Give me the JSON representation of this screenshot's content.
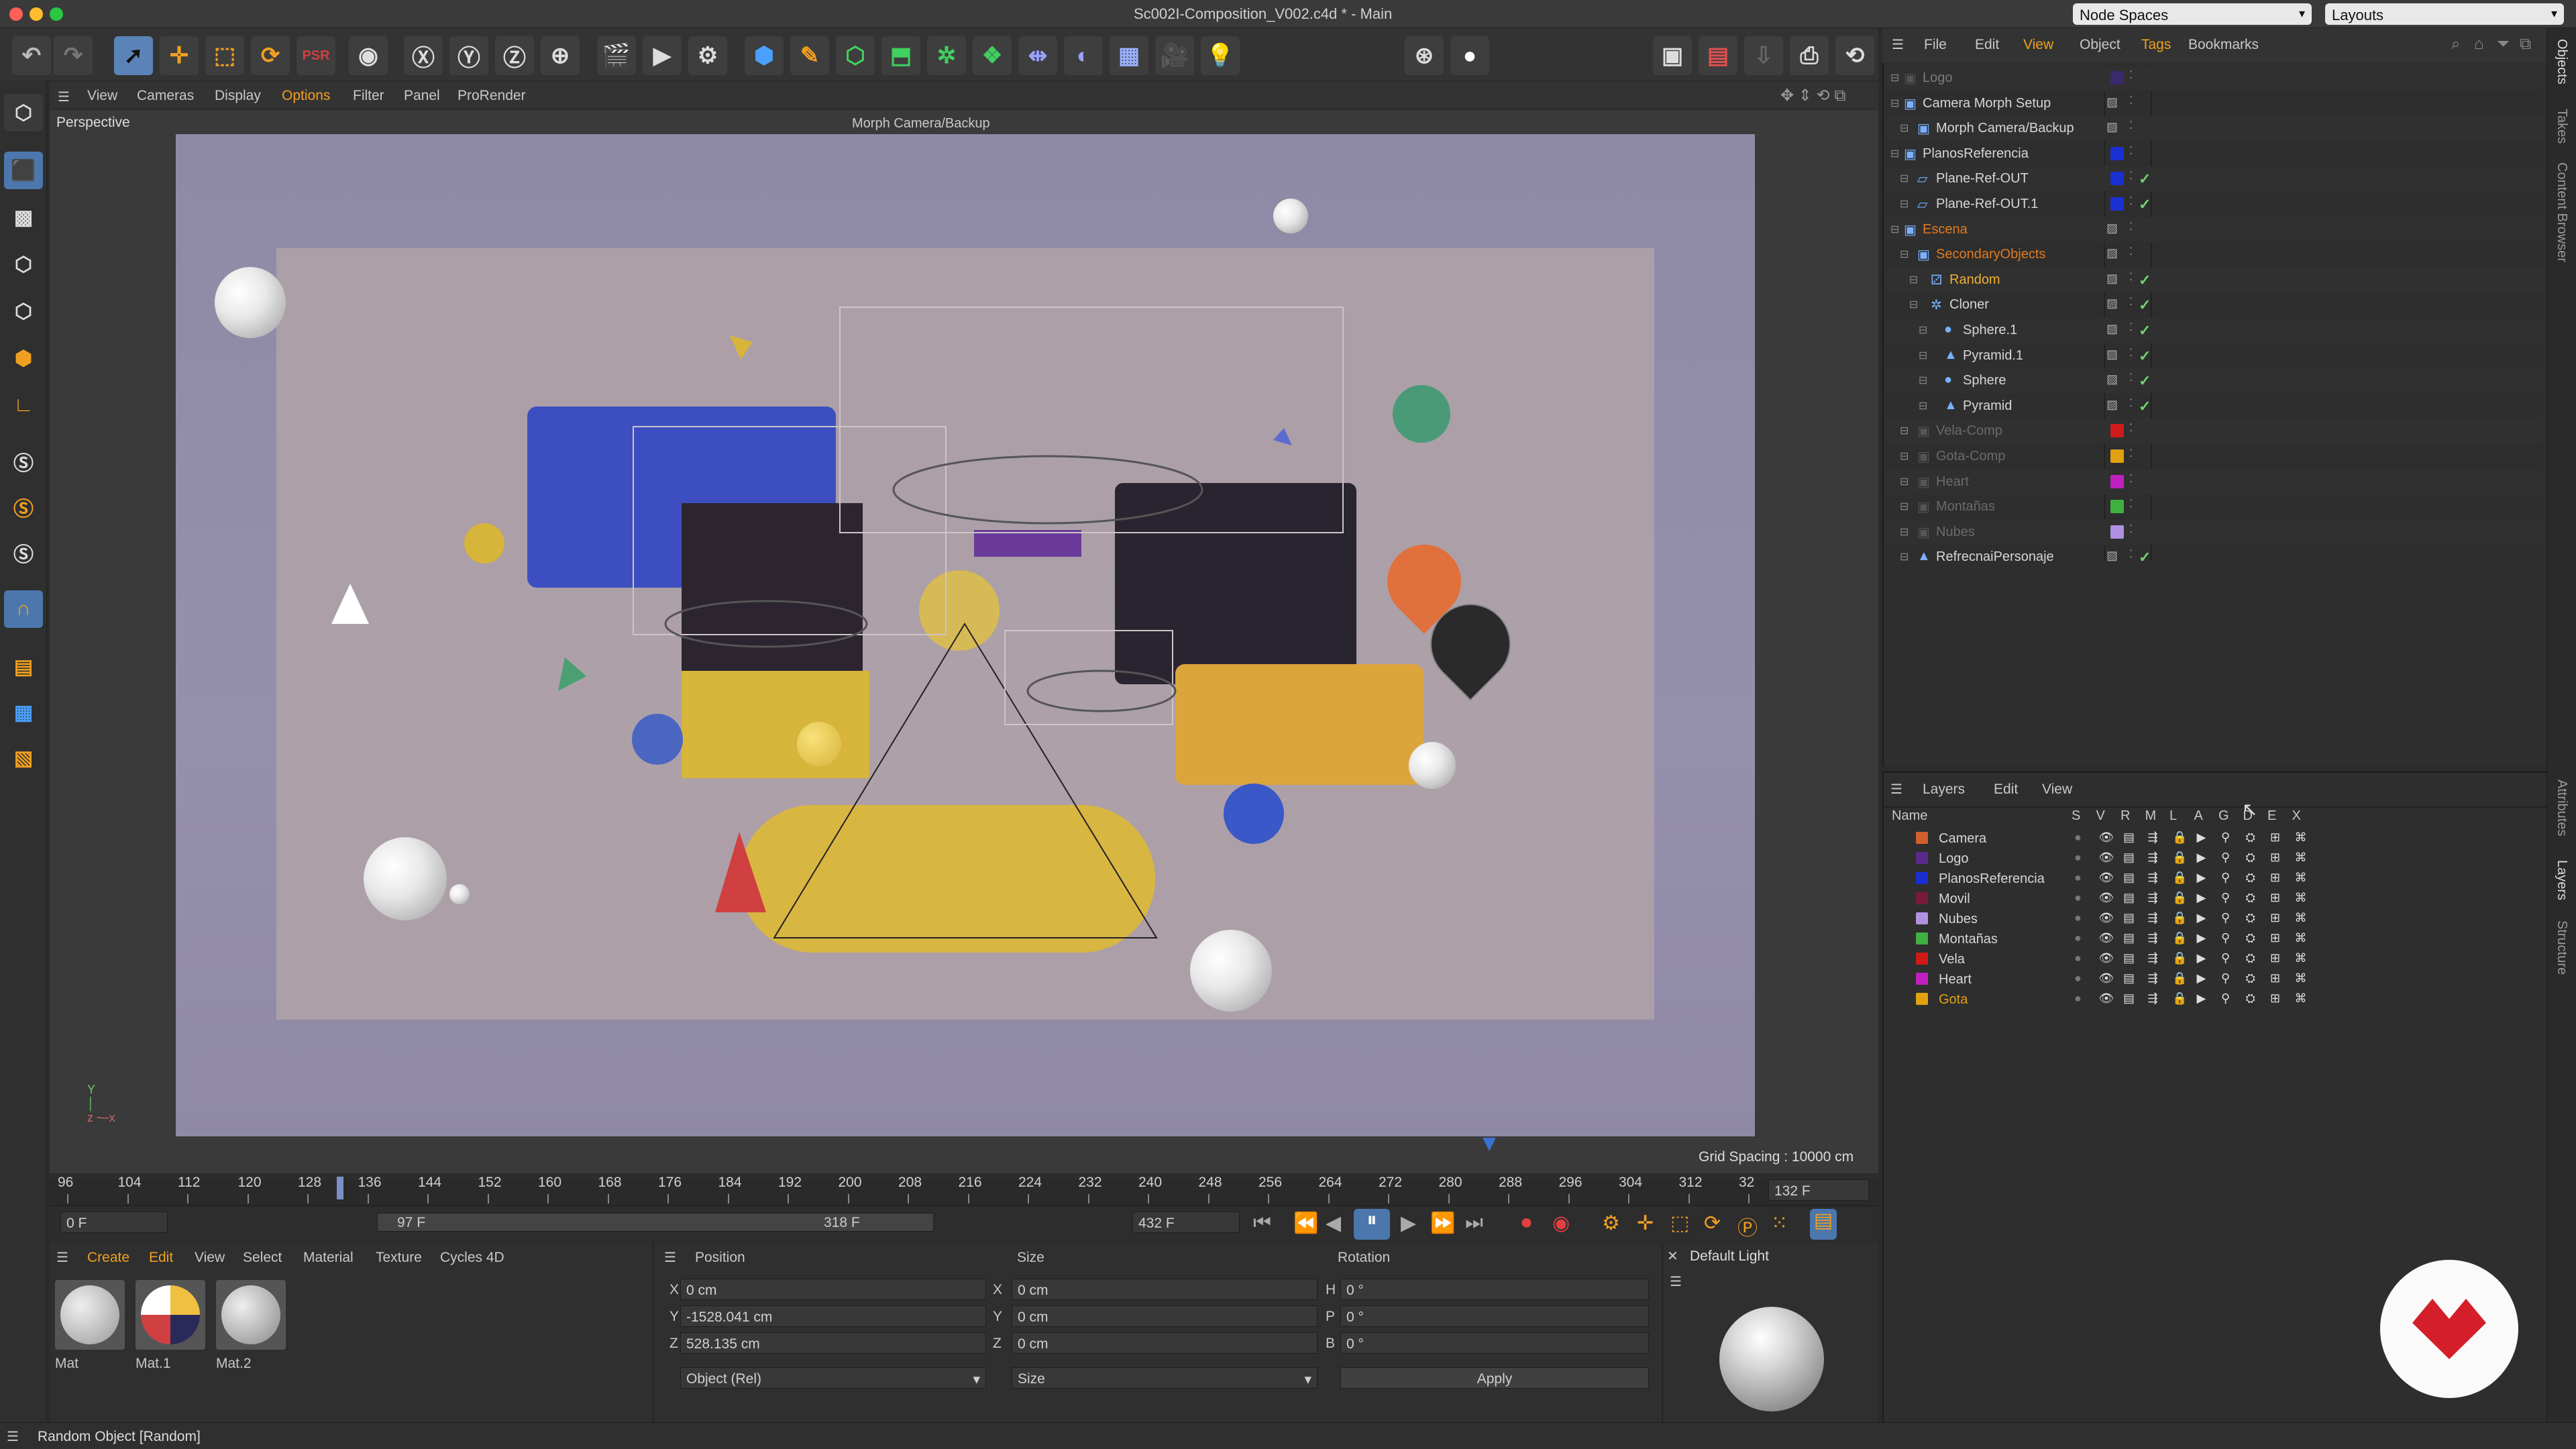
{
  "window": {
    "title": "Sc002I-Composition_V002.c4d * - Main"
  },
  "header_dropdowns": {
    "node_spaces": "Node Spaces",
    "layouts": "Layouts"
  },
  "viewport": {
    "menu": [
      "View",
      "Cameras",
      "Display",
      "Options",
      "Filter",
      "Panel",
      "ProRender"
    ],
    "label": "Perspective",
    "camera_name": "Morph Camera/Backup",
    "grid_spacing": "Grid Spacing : 10000 cm"
  },
  "timeline": {
    "ticks": [
      "96",
      "104",
      "112",
      "120",
      "128",
      "136",
      "144",
      "152",
      "160",
      "168",
      "176",
      "184",
      "192",
      "200",
      "208",
      "216",
      "224",
      "232",
      "240",
      "248",
      "256",
      "264",
      "272",
      "280",
      "288",
      "296",
      "304",
      "312",
      "32"
    ],
    "current_frame": "132 F",
    "start_field": "0 F",
    "range_start": "97 F",
    "range_end": "318 F",
    "end_field": "432 F"
  },
  "material_manager": {
    "menu": [
      "Create",
      "Edit",
      "View",
      "Select",
      "Material",
      "Texture",
      "Cycles 4D"
    ],
    "materials": [
      "Mat",
      "Mat.1",
      "Mat.2"
    ]
  },
  "coordinates": {
    "headers": {
      "position": "Position",
      "size": "Size",
      "rotation": "Rotation"
    },
    "rows": [
      {
        "axis": "X",
        "pos": "0 cm",
        "size_axis": "X",
        "size": "0 cm",
        "rot_axis": "H",
        "rot": "0 °"
      },
      {
        "axis": "Y",
        "pos": "-1528.041 cm",
        "size_axis": "Y",
        "size": "0 cm",
        "rot_axis": "P",
        "rot": "0 °"
      },
      {
        "axis": "Z",
        "pos": "528.135 cm",
        "size_axis": "Z",
        "size": "0 cm",
        "rot_axis": "B",
        "rot": "0 °"
      }
    ],
    "mode": "Object (Rel)",
    "size_mode": "Size",
    "apply": "Apply"
  },
  "light_panel": {
    "title": "Default Light"
  },
  "status": {
    "text": "Random Object [Random]"
  },
  "object_manager": {
    "menu": [
      "File",
      "Edit",
      "View",
      "Object",
      "Tags",
      "Bookmarks"
    ],
    "rows": [
      {
        "name": "Logo",
        "indent": 0,
        "color": "#7a7a7a",
        "swatch": "#3a2a6a",
        "dim": true
      },
      {
        "name": "Camera Morph Setup",
        "indent": 0,
        "color": "#d6d6d6",
        "swatch": "",
        "dim": false
      },
      {
        "name": "Morph Camera/Backup",
        "indent": 1,
        "color": "#d6d6d6",
        "swatch": "",
        "dim": false
      },
      {
        "name": "PlanosReferencia",
        "indent": 0,
        "color": "#d6d6d6",
        "swatch": "#1a2fd0",
        "dim": false
      },
      {
        "name": "Plane-Ref-OUT",
        "indent": 1,
        "color": "#d6d6d6",
        "swatch": "#1a2fd0",
        "dim": false
      },
      {
        "name": "Plane-Ref-OUT.1",
        "indent": 1,
        "color": "#d6d6d6",
        "swatch": "#1a2fd0",
        "dim": false
      },
      {
        "name": "Escena",
        "indent": 0,
        "color": "#e07a20",
        "swatch": "",
        "dim": false
      },
      {
        "name": "SecondaryObjects",
        "indent": 1,
        "color": "#e07a20",
        "swatch": "",
        "dim": false
      },
      {
        "name": "Random",
        "indent": 2,
        "color": "#f0b030",
        "swatch": "",
        "dim": false
      },
      {
        "name": "Cloner",
        "indent": 2,
        "color": "#d6d6d6",
        "swatch": "",
        "dim": false
      },
      {
        "name": "Sphere.1",
        "indent": 3,
        "color": "#d6d6d6",
        "swatch": "",
        "dim": false
      },
      {
        "name": "Pyramid.1",
        "indent": 3,
        "color": "#d6d6d6",
        "swatch": "",
        "dim": false
      },
      {
        "name": "Sphere",
        "indent": 3,
        "color": "#d6d6d6",
        "swatch": "",
        "dim": false
      },
      {
        "name": "Pyramid",
        "indent": 3,
        "color": "#d6d6d6",
        "swatch": "",
        "dim": false
      },
      {
        "name": "Vela-Comp",
        "indent": 1,
        "color": "#6a6a6a",
        "swatch": "#d01a1a",
        "dim": true
      },
      {
        "name": "Gota-Comp",
        "indent": 1,
        "color": "#6a6a6a",
        "swatch": "#e0a010",
        "dim": true
      },
      {
        "name": "Heart",
        "indent": 1,
        "color": "#6a6a6a",
        "swatch": "#c020c0",
        "dim": true
      },
      {
        "name": "Montañas",
        "indent": 1,
        "color": "#6a6a6a",
        "swatch": "#40b040",
        "dim": true
      },
      {
        "name": "Nubes",
        "indent": 1,
        "color": "#6a6a6a",
        "swatch": "#b090e0",
        "dim": true
      },
      {
        "name": "RefrecnaiPersonaje",
        "indent": 1,
        "color": "#d6d6d6",
        "swatch": "",
        "dim": false
      }
    ]
  },
  "layer_manager": {
    "menu": [
      "Layers",
      "Edit",
      "View"
    ],
    "columns": [
      "Name",
      "S",
      "V",
      "R",
      "M",
      "L",
      "A",
      "G",
      "D",
      "E",
      "X"
    ],
    "layers": [
      {
        "name": "Camera",
        "color": "#d0602a",
        "text": "#d6d6d6"
      },
      {
        "name": "Logo",
        "color": "#5a2a8a",
        "text": "#d6d6d6"
      },
      {
        "name": "PlanosReferencia",
        "color": "#1a2fd0",
        "text": "#d6d6d6"
      },
      {
        "name": "Movil",
        "color": "#7a1a3a",
        "text": "#d6d6d6"
      },
      {
        "name": "Nubes",
        "color": "#b090e0",
        "text": "#d6d6d6"
      },
      {
        "name": "Montañas",
        "color": "#40b040",
        "text": "#d6d6d6"
      },
      {
        "name": "Vela",
        "color": "#d01a1a",
        "text": "#d6d6d6"
      },
      {
        "name": "Heart",
        "color": "#c020c0",
        "text": "#d6d6d6"
      },
      {
        "name": "Gota",
        "color": "#e0a010",
        "text": "#e0a010"
      }
    ]
  },
  "side_tabs": [
    "Objects",
    "Takes",
    "Content Browser",
    "Attributes",
    "Layers",
    "Structure"
  ]
}
